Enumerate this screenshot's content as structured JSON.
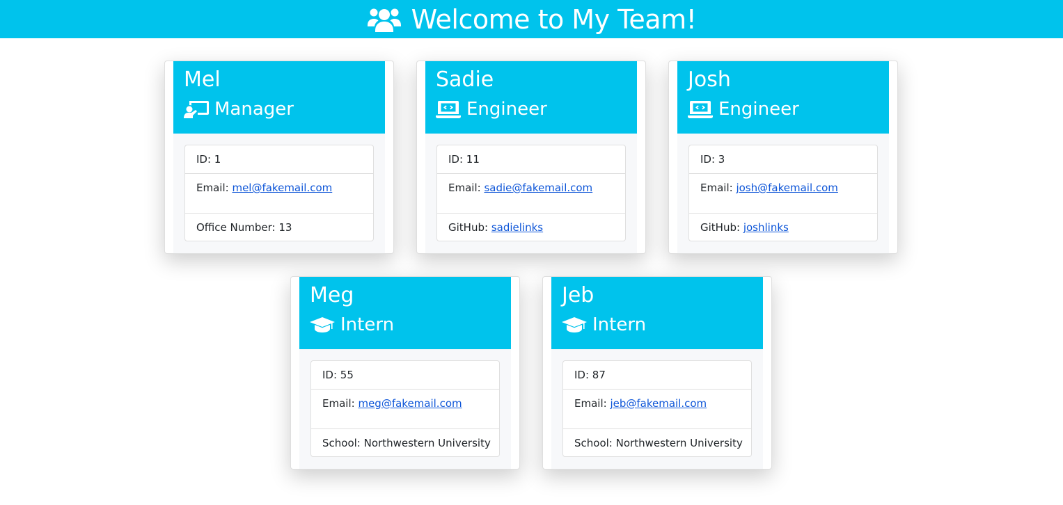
{
  "header": {
    "title": "Welcome to My Team!",
    "icon": "users-icon"
  },
  "colors": {
    "accent": "#00c3ec",
    "link": "#0d55d8"
  },
  "labels": {
    "id": "ID: ",
    "email": "Email: ",
    "office": "Office Number: ",
    "github": "GitHub: ",
    "school": "School: "
  },
  "members": [
    {
      "name": "Mel",
      "role": "Manager",
      "role_icon": "chalkboard-teacher-icon",
      "id": "1",
      "email": "mel@fakemail.com",
      "extra_label": "Office Number: ",
      "extra_value": "13"
    },
    {
      "name": "Sadie",
      "role": "Engineer",
      "role_icon": "laptop-code-icon",
      "id": "11",
      "email": "sadie@fakemail.com",
      "extra_label": "GitHub: ",
      "extra_value": "sadielinks"
    },
    {
      "name": "Josh",
      "role": "Engineer",
      "role_icon": "laptop-code-icon",
      "id": "3",
      "email": "josh@fakemail.com",
      "extra_label": "GitHub: ",
      "extra_value": "joshlinks"
    },
    {
      "name": "Meg",
      "role": "Intern",
      "role_icon": "graduation-cap-icon",
      "id": "55",
      "email": "meg@fakemail.com",
      "extra_label": "School: ",
      "extra_value": "Northwestern University"
    },
    {
      "name": "Jeb",
      "role": "Intern",
      "role_icon": "graduation-cap-icon",
      "id": "87",
      "email": "jeb@fakemail.com",
      "extra_label": "School: ",
      "extra_value": "Northwestern University"
    }
  ]
}
